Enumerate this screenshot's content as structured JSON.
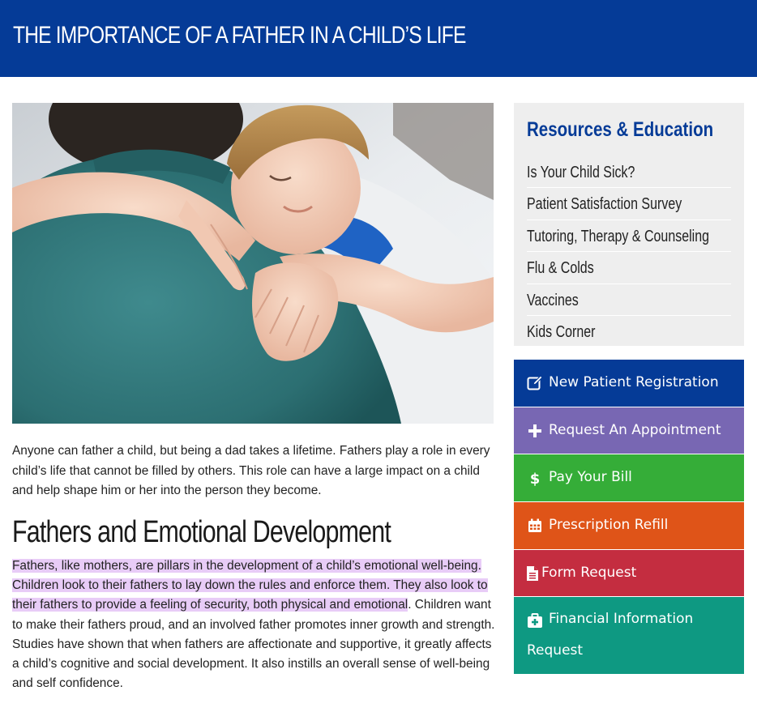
{
  "page": {
    "title": "THE IMPORTANCE OF A FATHER IN A CHILD’S LIFE"
  },
  "article": {
    "intro": "Anyone can father a child, but being a dad takes a lifetime. Fathers play a role in every child’s life that cannot be filled by others. This role can have a large impact on a child and help shape him or her into the person they become.",
    "section_title": "Fathers and Emotional Development",
    "highlighted_text": "Fathers, like mothers, are pillars in the development of a child’s emotional well-being. Children look to their fathers to lay down the rules and enforce them. They also look to their fathers to provide a feeling of security, both physical and emotional",
    "body_rest": ". Children want to make their fathers proud, and an involved father promotes inner growth and strength. Studies have shown that when fathers are affectionate and supportive, it greatly affects a child’s cognitive and social development. It also instills an overall sense of well-being and self confidence."
  },
  "sidebar": {
    "title": "Resources & Education",
    "links": [
      {
        "label": "Is Your Child Sick?"
      },
      {
        "label": "Patient Satisfaction Survey"
      },
      {
        "label": "Tutoring, Therapy & Counseling"
      },
      {
        "label": "Flu & Colds"
      },
      {
        "label": "Vaccines"
      },
      {
        "label": "Kids Corner"
      }
    ]
  },
  "actions": [
    {
      "label": "New Patient Registration",
      "icon": "edit-icon",
      "color": "#053b97"
    },
    {
      "label": "Request An Appointment",
      "icon": "plus-icon",
      "color": "#7867b3"
    },
    {
      "label": "Pay Your Bill",
      "icon": "dollar-icon",
      "color": "#35ad38"
    },
    {
      "label": "Prescription Refill",
      "icon": "calendar-icon",
      "color": "#df5418"
    },
    {
      "label": "Form Request",
      "icon": "document-icon",
      "color": "#c42d40"
    },
    {
      "label": "Financial Information",
      "label_line2": "Request",
      "icon": "medkit-icon",
      "color": "#0e9982"
    }
  ]
}
